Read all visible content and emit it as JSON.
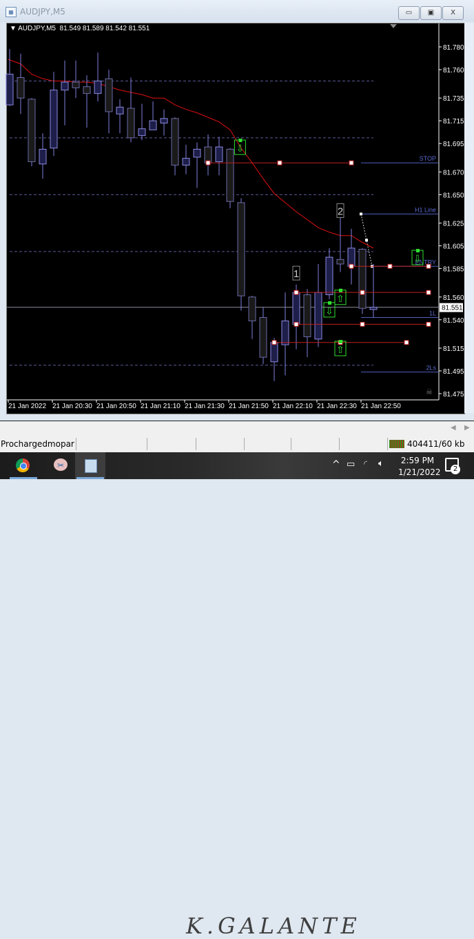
{
  "window": {
    "title": "AUDJPY,M5",
    "minimize": "▭",
    "maximize": "▣",
    "close": "X"
  },
  "chart_header": {
    "symbol": "AUDJPY,M5",
    "open": "81.549",
    "high": "81.589",
    "low": "81.542",
    "close": "81.551"
  },
  "price_axis": [
    "81.780",
    "81.760",
    "81.735",
    "81.715",
    "81.695",
    "81.670",
    "81.650",
    "81.625",
    "81.605",
    "81.585",
    "81.560",
    "81.540",
    "81.515",
    "81.495",
    "81.475"
  ],
  "current_price": "81.551",
  "time_axis": [
    "21 Jan 2022",
    "21 Jan 20:30",
    "21 Jan 20:50",
    "21 Jan 21:10",
    "21 Jan 21:30",
    "21 Jan 21:50",
    "21 Jan 22:10",
    "21 Jan 22:30",
    "21 Jan 22:50"
  ],
  "line_labels": {
    "stop": "STOP",
    "h1": "H1 Line",
    "entry": "ENTRY",
    "one_l": "1L",
    "two_ls": "2Ls"
  },
  "markers": {
    "one": "1",
    "two": "2"
  },
  "colors": {
    "background": "#000000",
    "bull_body": "#1e1e4a",
    "bear_body": "#1a1a1a",
    "candle_outline": "#8080d0",
    "moving_average": "#e01010",
    "level_lines": "#5060c0",
    "trade_lines": "#c02020",
    "arrows": "#30e030"
  },
  "chart_data": {
    "type": "candlestick",
    "symbol": "AUDJPY",
    "timeframe": "M5",
    "ylim": [
      81.475,
      81.78
    ],
    "candles": [
      [
        81.729,
        81.778,
        81.728,
        81.756
      ],
      [
        81.753,
        81.774,
        81.721,
        81.735
      ],
      [
        81.734,
        81.735,
        81.675,
        81.679
      ],
      [
        81.677,
        81.704,
        81.664,
        81.69
      ],
      [
        81.691,
        81.758,
        81.684,
        81.742
      ],
      [
        81.742,
        81.768,
        81.711,
        81.749
      ],
      [
        81.749,
        81.768,
        81.735,
        81.744
      ],
      [
        81.745,
        81.755,
        81.709,
        81.739
      ],
      [
        81.739,
        81.775,
        81.732,
        81.75
      ],
      [
        81.752,
        81.76,
        81.704,
        81.723
      ],
      [
        81.721,
        81.734,
        81.704,
        81.727
      ],
      [
        81.726,
        81.753,
        81.696,
        81.7
      ],
      [
        81.702,
        81.73,
        81.698,
        81.708
      ],
      [
        81.707,
        81.732,
        81.707,
        81.715
      ],
      [
        81.713,
        81.725,
        81.702,
        81.717
      ],
      [
        81.717,
        81.718,
        81.667,
        81.676
      ],
      [
        81.676,
        81.694,
        81.668,
        81.682
      ],
      [
        81.683,
        81.696,
        81.656,
        81.69
      ],
      [
        81.692,
        81.703,
        81.667,
        81.678
      ],
      [
        81.679,
        81.701,
        81.667,
        81.692
      ],
      [
        81.69,
        81.691,
        81.638,
        81.644
      ],
      [
        81.643,
        81.647,
        81.548,
        81.561
      ],
      [
        81.56,
        81.561,
        81.523,
        81.539
      ],
      [
        81.542,
        81.551,
        81.501,
        81.507
      ],
      [
        81.503,
        81.524,
        81.486,
        81.52
      ],
      [
        81.518,
        81.564,
        81.491,
        81.539
      ],
      [
        81.536,
        81.571,
        81.514,
        81.564
      ],
      [
        81.562,
        81.567,
        81.507,
        81.525
      ],
      [
        81.523,
        81.589,
        81.516,
        81.564
      ],
      [
        81.562,
        81.603,
        81.558,
        81.595
      ],
      [
        81.593,
        81.641,
        81.582,
        81.589
      ],
      [
        81.587,
        81.62,
        81.571,
        81.603
      ],
      [
        81.602,
        81.603,
        81.545,
        81.55
      ],
      [
        81.549,
        81.589,
        81.542,
        81.551
      ]
    ],
    "moving_average": [
      81.769,
      81.765,
      81.756,
      81.752,
      81.75,
      81.75,
      81.749,
      81.749,
      81.748,
      81.745,
      81.742,
      81.74,
      81.738,
      81.735,
      81.735,
      81.729,
      81.725,
      81.722,
      81.718,
      81.714,
      81.707,
      81.691,
      81.678,
      81.664,
      81.651,
      81.643,
      81.635,
      81.628,
      81.621,
      81.617,
      81.614,
      81.614,
      81.608,
      81.603
    ],
    "grid_levels": [
      81.75,
      81.7,
      81.65,
      81.6,
      81.5
    ],
    "levels": {
      "stop": 81.678,
      "h1": 81.633,
      "entry": 81.587,
      "one_l": 81.542,
      "two_ls": 81.494
    },
    "trade_lines": [
      {
        "price": 81.678,
        "from": 18,
        "to": 31
      },
      {
        "price": 81.587,
        "from": 31,
        "to": 38
      },
      {
        "price": 81.564,
        "from": 26,
        "to": 38
      },
      {
        "price": 81.536,
        "from": 26,
        "to": 38
      },
      {
        "price": 81.52,
        "from": 24,
        "to": 36
      }
    ],
    "arrows": [
      {
        "dir": "down",
        "bar": 20.9,
        "price": 81.692
      },
      {
        "dir": "up",
        "bar": 30,
        "price": 81.56
      },
      {
        "dir": "down",
        "bar": 29,
        "price": 81.549
      },
      {
        "dir": "up",
        "bar": 30,
        "price": 81.515
      },
      {
        "dir": "down",
        "bar": 37,
        "price": 81.595
      }
    ],
    "number_labels": [
      {
        "text": "1",
        "bar": 26,
        "price": 81.581
      },
      {
        "text": "2",
        "bar": 30,
        "price": 81.636
      }
    ]
  },
  "status": {
    "account": "Prochargedmopar",
    "traffic": "404411/60 kb"
  },
  "taskbar": {
    "time": "2:59 PM",
    "date": "1/21/2022",
    "notifications": "2",
    "watermark": "K.GALANTE"
  }
}
